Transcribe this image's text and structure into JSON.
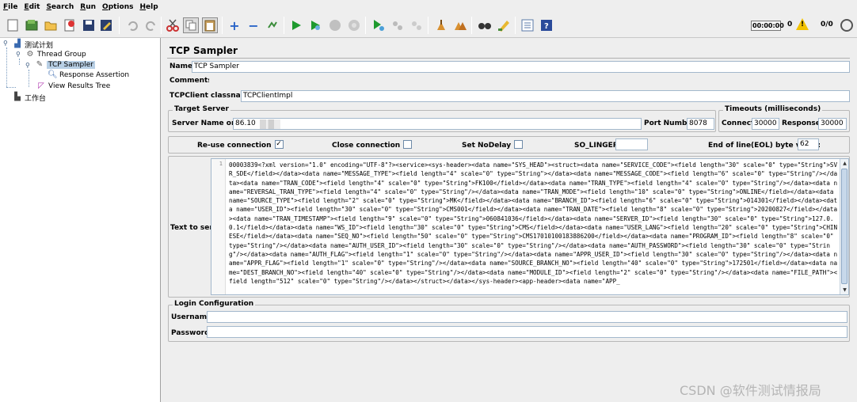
{
  "menu": [
    "File",
    "Edit",
    "Search",
    "Run",
    "Options",
    "Help"
  ],
  "toolbar": {
    "timer": "00:00:00",
    "warning_count": "0",
    "thread_ratio": "0/0",
    "icons": [
      "new-icon",
      "templates-icon",
      "open-icon",
      "close-icon",
      "save-icon",
      "save-as-icon",
      "undo-icon",
      "redo-icon",
      "cut-icon",
      "copy-icon",
      "paste-icon",
      "expand-icon",
      "collapse-icon",
      "toggle-icon",
      "start-icon",
      "start-no-pause-icon",
      "stop-icon",
      "shutdown-icon",
      "remote-start-icon",
      "remote-stop-icon",
      "remote-shutdown-icon",
      "clear-icon",
      "clear-all-icon",
      "search-icon",
      "reset-search-icon",
      "function-helper-icon",
      "help-icon",
      "warning-icon",
      "remote-status-icon"
    ]
  },
  "tree": {
    "test_plan": "测试计划",
    "thread_group": "Thread Group",
    "tcp_sampler": "TCP Sampler",
    "response_assertion": "Response Assertion",
    "view_results_tree": "View Results Tree",
    "workbench": "工作台"
  },
  "panel": {
    "title": "TCP Sampler",
    "name_label": "Name:",
    "name_value": "TCP Sampler",
    "comments_label": "Comments:",
    "comments_value": "",
    "classname_label": "TCPClient classname:",
    "classname_value": "TCPClientImpl",
    "target_server_title": "Target Server",
    "server_label": "Server Name or IP:",
    "server_value": "86.10",
    "port_label": "Port Number:",
    "port_value": "8078",
    "timeouts_title": "Timeouts (milliseconds)",
    "connect_label": "Connect:",
    "connect_value": "30000",
    "response_label": "Response:",
    "response_value": "30000",
    "reuse_label": "Re-use connection",
    "reuse_checked": "✓",
    "close_label": "Close connection",
    "nodelay_label": "Set NoDelay",
    "solinger_label": "SO_LINGER:",
    "solinger_value": "",
    "eol_label": "End of line(EOL) byte value:",
    "eol_value": "62",
    "text_to_send_label": "Text to send",
    "line_number": "1",
    "text_to_send": "00003839<?xml version=\"1.0\" encoding=\"UTF-8\"?><service><sys-header><data name=\"SYS_HEAD\"><struct><data name=\"SERVICE_CODE\"><field length=\"30\" scale=\"0\" type=\"String\">SVR_SDE</field></data><data name=\"MESSAGE_TYPE\"><field length=\"4\" scale=\"0\" type=\"String\"></data><data name=\"MESSAGE_CODE\"><field length=\"6\" scale=\"0\" type=\"String\"/></data><data name=\"TRAN_CODE\"><field length=\"4\" scale=\"0\" type=\"String\">FK100</field></data><data name=\"TRAN_TYPE\"><field length=\"4\" scale=\"0\" type=\"String\"/></data><data name=\"REVERSAL_TRAN_TYPE\"><field length=\"4\" scale=\"0\" type=\"String\"/></data><data name=\"TRAN_MODE\"><field length=\"10\" scale=\"0\" type=\"String\">ONLINE</field></data><data name=\"SOURCE_TYPE\"><field length=\"2\" scale=\"0\" type=\"String\">MK</field></data><data name=\"BRANCH_ID\"><field length=\"6\" scale=\"0\" type=\"String\">014301</field></data><data name=\"USER_ID\"><field length=\"30\" scale=\"0\" type=\"String\">CMS001</field></data><data name=\"TRAN_DATE\"><field length=\"8\" scale=\"0\" type=\"String\">20200827</field></data><data name=\"TRAN_TIMESTAMP\"><field length=\"9\" scale=\"0\" type=\"String\">060841036</field></data><data name=\"SERVER_ID\"><field length=\"30\" scale=\"0\" type=\"String\">127.0.0.1</field></data><data name=\"WS_ID\"><field length=\"30\" scale=\"0\" type=\"String\">CMS</field></data><data name=\"USER_LANG\"><field length=\"20\" scale=\"0\" type=\"String\">CHINESE</field></data><data name=\"SEQ_NO\"><field length=\"50\" scale=\"0\" type=\"String\">CMS17010100183886200</field></data><data name=\"PROGRAM_ID\"><field length=\"8\" scale=\"0\" type=\"String\"/></data><data name=\"AUTH_USER_ID\"><field length=\"30\" scale=\"0\" type=\"String\"/></data><data name=\"AUTH_PASSWORD\"><field length=\"30\" scale=\"0\" type=\"String\"/></data><data name=\"AUTH_FLAG\"><field length=\"1\" scale=\"0\" type=\"String\"/></data><data name=\"APPR_USER_ID\"><field length=\"30\" scale=\"0\" type=\"String\"/></data><data name=\"APPR_FLAG\"><field length=\"1\" scale=\"0\" type=\"String\"/></data><data name=\"SOURCE_BRANCH_NO\"><field length=\"40\" scale=\"0\" type=\"String\">172501</field></data><data name=\"DEST_BRANCH_NO\"><field length=\"40\" scale=\"0\" type=\"String\"/></data><data name=\"MODULE_ID\"><field length=\"2\" scale=\"0\" type=\"String\"/></data><data name=\"FILE_PATH\"><field length=\"512\" scale=\"0\" type=\"String\"/></data></struct></data></sys-header><app-header><data name=\"APP_",
    "login_config_title": "Login Configuration",
    "username_label": "Username",
    "username_value": "",
    "password_label": "Password",
    "password_value": ""
  },
  "watermark": "CSDN @软件测试情报局"
}
